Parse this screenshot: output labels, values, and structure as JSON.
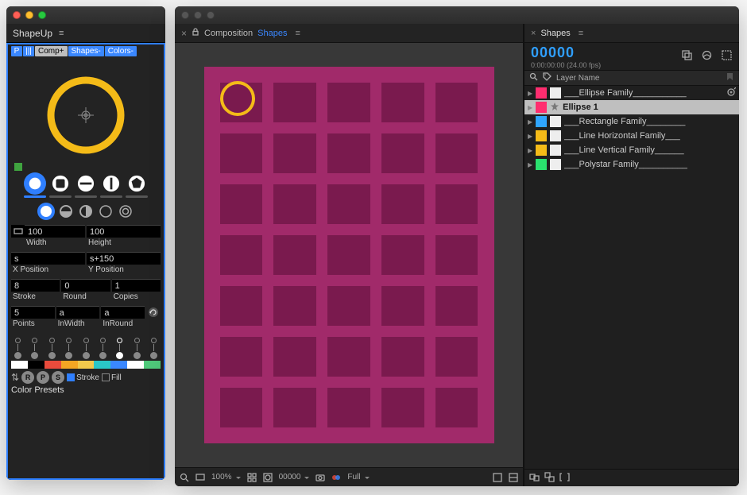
{
  "left_panel": {
    "title": "ShapeUp",
    "chips": {
      "p": "P",
      "bars": "|||",
      "comp": "Comp+",
      "shapes": "Shapes-",
      "colors": "Colors-"
    },
    "fields": {
      "width": {
        "value": "100",
        "label": "Width"
      },
      "height": {
        "value": "100",
        "label": "Height"
      },
      "xpos": {
        "value": "s",
        "label": "X Position"
      },
      "ypos": {
        "value": "s+150",
        "label": "Y Position"
      },
      "stroke": {
        "value": "8",
        "label": "Stroke"
      },
      "round": {
        "value": "0",
        "label": "Round"
      },
      "copies": {
        "value": "1",
        "label": "Copies"
      },
      "points": {
        "value": "5",
        "label": "Points"
      },
      "inwidth": {
        "value": "a",
        "label": "InWidth"
      },
      "inround": {
        "value": "a",
        "label": "InRound"
      }
    },
    "swatch_colors": [
      "#ffffff",
      "#000000",
      "#e94b3c",
      "#f4a623",
      "#f2c94c",
      "#2ac7c7",
      "#3a87ff",
      "#ffffff",
      "#4fc97a"
    ],
    "bottom": {
      "r": "R",
      "p": "P",
      "s": "S",
      "stroke_label": "Stroke",
      "fill_label": "Fill",
      "presets": "Color Presets"
    }
  },
  "composition": {
    "tab_label": "Composition",
    "name": "Shapes",
    "footer": {
      "zoom": "100%",
      "timecode": "00000",
      "res": "Full"
    },
    "grid": {
      "cols": 5,
      "rows": 7
    }
  },
  "right_panel": {
    "tab": "Shapes",
    "timecode": "00000",
    "tc_sub": "0:00:00:00 (24.00 fps)",
    "layer_name_header": "Layer Name",
    "layers": [
      {
        "color": "#ff2d6f",
        "name": "___Ellipse Family___________",
        "selected": false,
        "end_icon": true
      },
      {
        "color": "#ff2d6f",
        "name": "Ellipse 1",
        "selected": true,
        "star": true
      },
      {
        "color": "#2fa5ff",
        "name": "___Rectangle Family________"
      },
      {
        "color": "#f4bb18",
        "name": "___Line Horizontal Family___"
      },
      {
        "color": "#f4bb18",
        "name": "___Line Vertical Family______"
      },
      {
        "color": "#2ae06e",
        "name": "___Polystar Family__________"
      }
    ]
  }
}
